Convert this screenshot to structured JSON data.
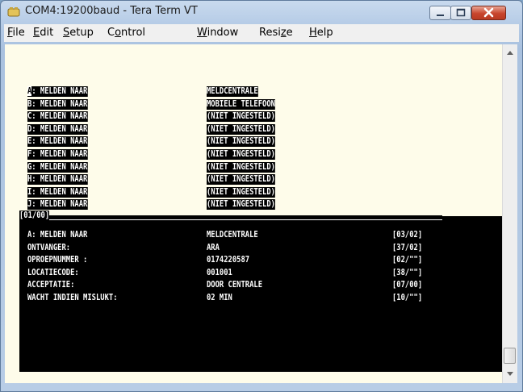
{
  "window": {
    "title": "COM4:19200baud - Tera Term VT",
    "buttons": {
      "minimize": "minimize-icon",
      "maximize": "maximize-icon",
      "close": "close-icon"
    }
  },
  "menu": {
    "items": [
      {
        "key": "F",
        "rest": "ile"
      },
      {
        "key": "E",
        "rest": "dit"
      },
      {
        "key": "S",
        "rest": "etup"
      },
      {
        "pre": "C",
        "key": "o",
        "rest": "ntrol"
      },
      {
        "key": "W",
        "rest": "indow"
      },
      {
        "pre": "Resi",
        "key": "z",
        "rest": "e"
      },
      {
        "key": "H",
        "rest": "elp"
      }
    ]
  },
  "terminal": {
    "list_rows": [
      {
        "cursor": "A",
        "label": ": MELDEN NAAR",
        "value": "MELDCENTRALE"
      },
      {
        "label": "B: MELDEN NAAR",
        "value": "MOBIELE TELEFOON"
      },
      {
        "label": "C: MELDEN NAAR",
        "value": "(NIET INGESTELD)"
      },
      {
        "label": "D: MELDEN NAAR",
        "value": "(NIET INGESTELD)"
      },
      {
        "label": "E: MELDEN NAAR",
        "value": "(NIET INGESTELD)"
      },
      {
        "label": "F: MELDEN NAAR",
        "value": "(NIET INGESTELD)"
      },
      {
        "label": "G: MELDEN NAAR",
        "value": "(NIET INGESTELD)"
      },
      {
        "label": "H: MELDEN NAAR",
        "value": "(NIET INGESTELD)"
      },
      {
        "label": "I: MELDEN NAAR",
        "value": "(NIET INGESTELD)"
      },
      {
        "label": "J: MELDEN NAAR",
        "value": "(NIET INGESTELD)"
      }
    ],
    "section_header": "[01/00]",
    "detail_rows": [
      {
        "label": "A: MELDEN NAAR",
        "value": "MELDCENTRALE",
        "code": "[03/02]"
      },
      {
        "label": "ONTVANGER:",
        "value": "ARA",
        "code": "[37/02]"
      },
      {
        "label": "OPROEPNUMMER :",
        "value": "0174220587",
        "code": "[02/\"\"]"
      },
      {
        "label": "LOCATIECODE:",
        "value": "001001",
        "code": "[38/\"\"]"
      },
      {
        "label": "ACCEPTATIE:",
        "value": "DOOR CENTRALE",
        "code": "[07/00]"
      },
      {
        "label": "WACHT INDIEN MISLUKT:",
        "value": "02 MIN",
        "code": "[10/\"\"]"
      }
    ]
  },
  "colors": {
    "terminal_bg": "#fefcea",
    "terminal_fg": "#000000",
    "inverse_bg": "#000000",
    "inverse_fg": "#ffffff"
  }
}
